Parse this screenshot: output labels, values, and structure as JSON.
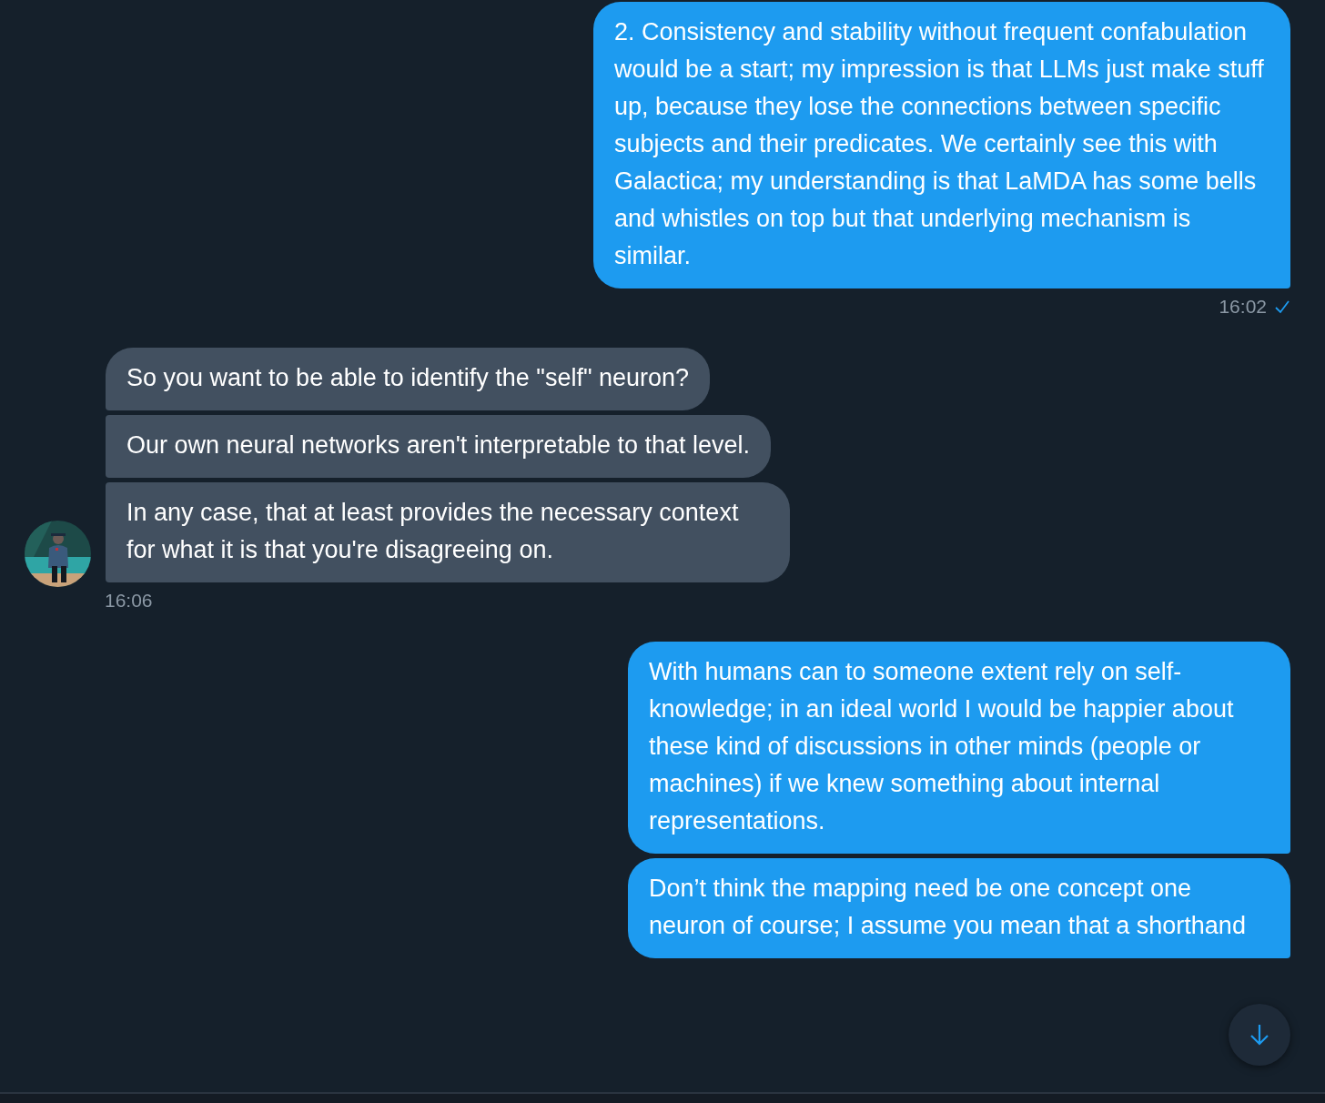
{
  "groups": [
    {
      "kind": "sent",
      "messages": [
        "2. Consistency and stability without frequent confabulation would be a start; my impression is that LLMs just make stuff up, because they lose the connections between specific subjects and their predicates. We certainly see this with Galactica; my understanding is that LaMDA has some bells and whistles on top but that underlying mechanism is similar."
      ],
      "time": "16:02",
      "read": true
    },
    {
      "kind": "received",
      "messages": [
        "So you want to be able to identify the \"self\" neuron?",
        "Our own neural networks aren't interpretable to that level.",
        "In any case, that at least provides the necessary context for what it is that you're disagreeing on."
      ],
      "time": "16:06"
    },
    {
      "kind": "sent",
      "messages": [
        "With humans can to someone extent rely on self-knowledge; in an ideal world I would be happier about these kind of discussions in other minds (people or machines) if we knew something about internal representations.",
        "Don’t think the mapping need be one concept one neuron of course; I assume you mean that a shorthand"
      ]
    }
  ],
  "scroll_button": {
    "kind": "down"
  }
}
